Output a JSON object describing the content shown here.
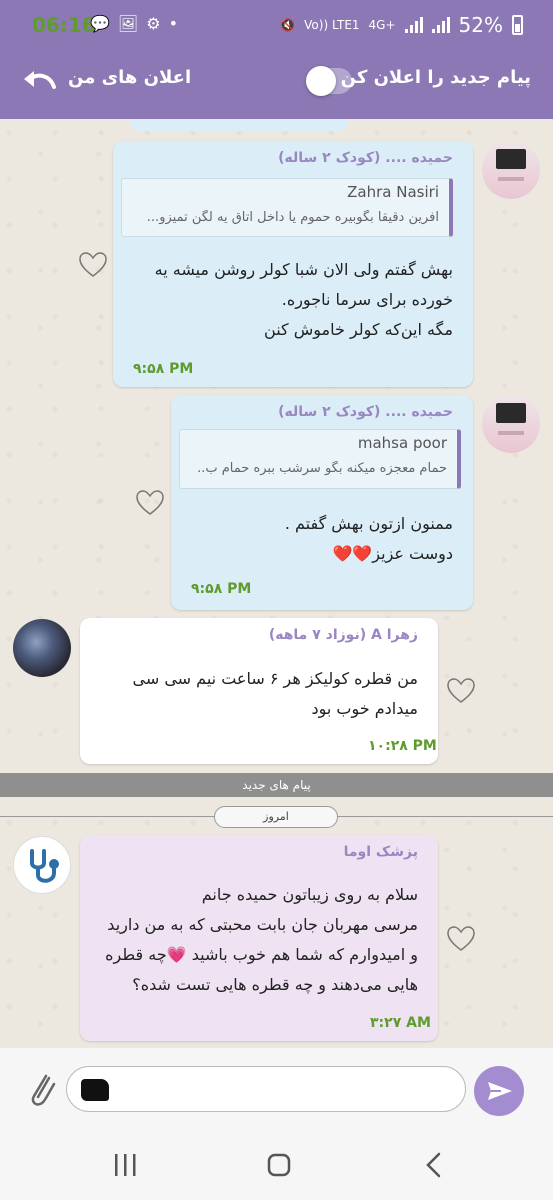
{
  "status_bar": {
    "time": "06:16",
    "network": "Vo)) LTE1",
    "network_type": "4G+",
    "battery": "52%"
  },
  "header": {
    "notify_label": "پیام جدید را اعلان کن",
    "toggle_state": "off",
    "title": "اعلان های من"
  },
  "messages": [
    {
      "sender": "حمیده .... (کودک ۲ ساله)",
      "quote_name": "Zahra Nasiri",
      "quote_text": "افرین دقیقا بگوبیره حموم یا داخل اتاق یه لگن تمیزو...",
      "text": "بهش گفتم ولی الان شبا کولر روشن میشه یه\nخورده برای سرما ناجوره.\nمگه این‌که کولر خاموش کنن",
      "time": "۹:۵۸ PM"
    },
    {
      "sender": "حمیده .... (کودک ۲ ساله)",
      "quote_name": "mahsa poor",
      "quote_text": "حمام معجزه میکنه بگو سرشب ببره حمام ب..",
      "text": "ممنون ازتون بهش گفتم .\nدوست عزیز❤️❤️",
      "time": "۹:۵۸ PM"
    },
    {
      "sender": "زهرا A (نوزاد ۷ ماهه)",
      "text": "من قطره کولیکز هر ۶ ساعت نیم سی سی\nمیدادم  خوب بود",
      "time": "۱۰:۲۸ PM"
    },
    {
      "sender": "پزشک اوما",
      "text": "سلام به روی زیباتون حمیده جانم\nمرسی مهربان جان بابت محبتی که به من دارید\nو امیدوارم که شما هم خوب باشید 💗چه قطره\nهایی می‌دهند و چه قطره هایی تست شده؟",
      "time": "۳:۲۷ AM"
    }
  ],
  "new_messages_label": "پیام های جدید",
  "day_label": "امروز",
  "colors": {
    "header": "#8b78b4",
    "outgoing_bubble": "#dbeef8",
    "doctor_bubble": "#efe3f3",
    "time_green": "#5f9b2e",
    "send_button": "#a48cd0"
  }
}
